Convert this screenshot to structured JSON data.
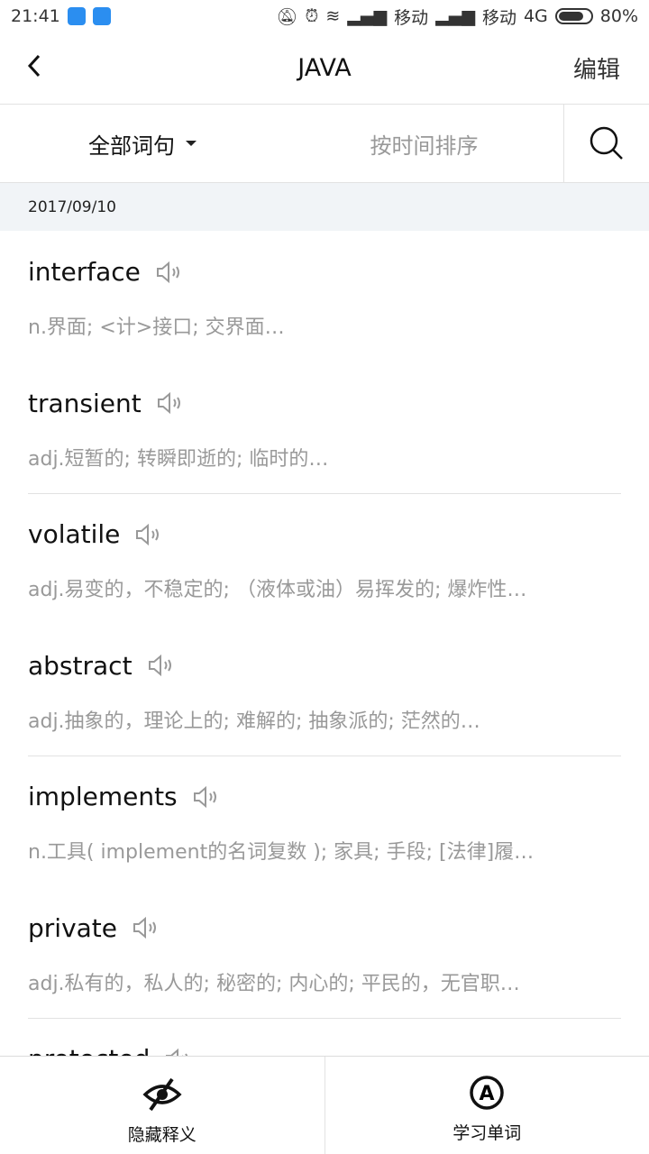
{
  "status": {
    "time": "21:41",
    "carrier1": "移动",
    "carrier2": "移动",
    "network": "4G",
    "battery": "80%",
    "battery_level": 0.8
  },
  "header": {
    "title": "JAVA",
    "edit": "编辑"
  },
  "filter": {
    "category": "全部词句",
    "sort": "按时间排序"
  },
  "date": "2017/09/10",
  "words": [
    {
      "word": "interface",
      "def": "n.界面; <计>接口; 交界面…"
    },
    {
      "word": "transient",
      "def": "adj.短暂的; 转瞬即逝的; 临时的…"
    },
    {
      "word": "volatile",
      "def": "adj.易变的，不稳定的; （液体或油）易挥发的; 爆炸性…"
    },
    {
      "word": "abstract",
      "def": "adj.抽象的，理论上的; 难解的; 抽象派的; 茫然的…"
    },
    {
      "word": "implements",
      "def": "n.工具( implement的名词复数 ); 家具; 手段; [法律]履…"
    },
    {
      "word": "private",
      "def": "adj.私有的，私人的; 秘密的; 内心的; 平民的，无官职…"
    },
    {
      "word": "protected",
      "def": ""
    }
  ],
  "bottom": {
    "hide": "隐藏释义",
    "learn": "学习单词"
  }
}
